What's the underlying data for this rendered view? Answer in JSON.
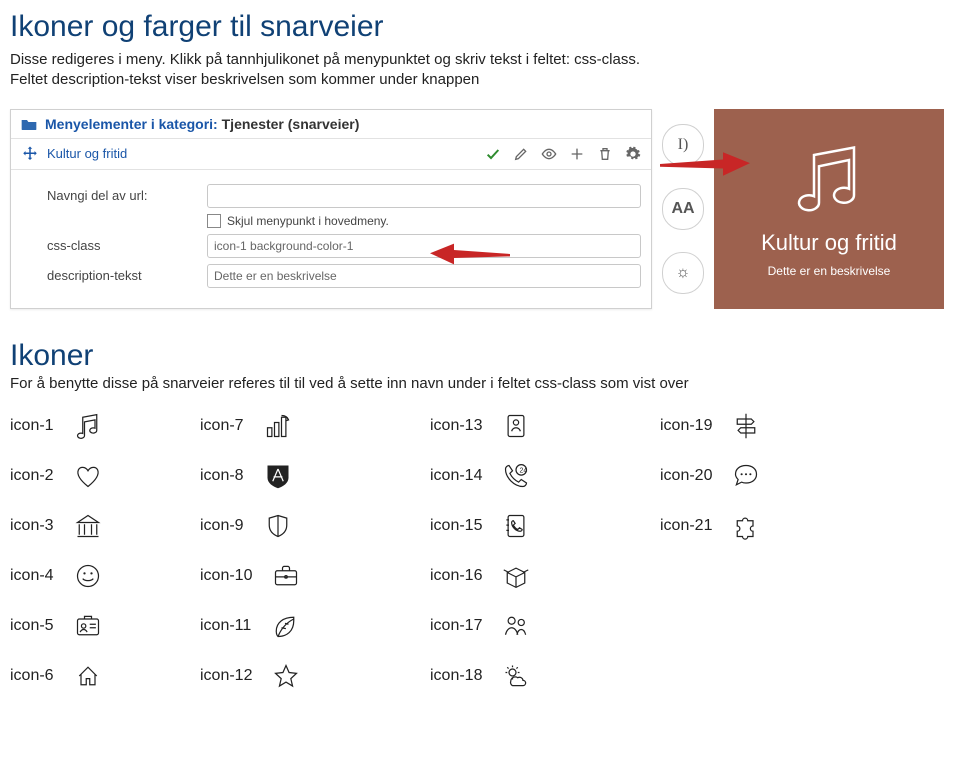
{
  "header": {
    "title": "Ikoner og farger til snarveier",
    "intro_line1": "Disse redigeres i meny. Klikk på tannhjulikonet på menypunktet og skriv tekst i feltet: css-class.",
    "intro_line2": "Feltet description-tekst viser beskrivelsen som kommer under knappen"
  },
  "admin": {
    "category_prefix": "Menyelementer i kategori:",
    "category_name": "Tjenester (snarveier)",
    "item_title": "Kultur og fritid",
    "url_label": "Navngi del av url:",
    "checkbox_label": "Skjul menypunkt i hovedmeny.",
    "css_label": "css-class",
    "css_value": "icon-1 background-color-1",
    "desc_label": "description-tekst",
    "desc_value": "Dette er en beskrivelse",
    "side_i": "I)",
    "side_aa": "AA",
    "side_sun": "☼"
  },
  "tile": {
    "title": "Kultur og fritid",
    "desc": "Dette er en beskrivelse"
  },
  "section": {
    "title": "Ikoner",
    "sub": "For å benytte disse på snarveier referes til til ved å sette inn navn under i feltet css-class som vist over"
  },
  "icons": {
    "c1": [
      "icon-1",
      "icon-2",
      "icon-3",
      "icon-4",
      "icon-5",
      "icon-6"
    ],
    "c2": [
      "icon-7",
      "icon-8",
      "icon-9",
      "icon-10",
      "icon-11",
      "icon-12"
    ],
    "c3": [
      "icon-13",
      "icon-14",
      "icon-15",
      "icon-16",
      "icon-17",
      "icon-18"
    ],
    "c4": [
      "icon-19",
      "icon-20",
      "icon-21"
    ]
  }
}
